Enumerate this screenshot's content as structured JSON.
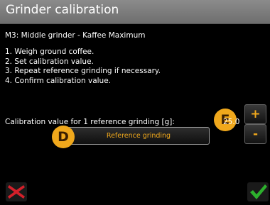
{
  "title": "Grinder calibration",
  "subtitle": "M3: Middle grinder  - Kaffee Maximum",
  "steps": [
    "1. Weigh ground coffee.",
    "2. Set calibration value.",
    "3. Repeat reference grinding if necessary.",
    "4. Confirm calibration value."
  ],
  "calibration": {
    "label": "Calibration value for 1 reference grinding [g]:",
    "value": "25.0",
    "plus_label": "+",
    "minus_label": "-"
  },
  "badges": {
    "e": "E",
    "d": "D"
  },
  "reference_button_label": "Reference grinding",
  "icons": {
    "cancel": "cross-icon",
    "confirm": "check-icon"
  },
  "colors": {
    "accent": "#f0a81c",
    "cancel": "#d4202a",
    "confirm": "#2db02d"
  }
}
